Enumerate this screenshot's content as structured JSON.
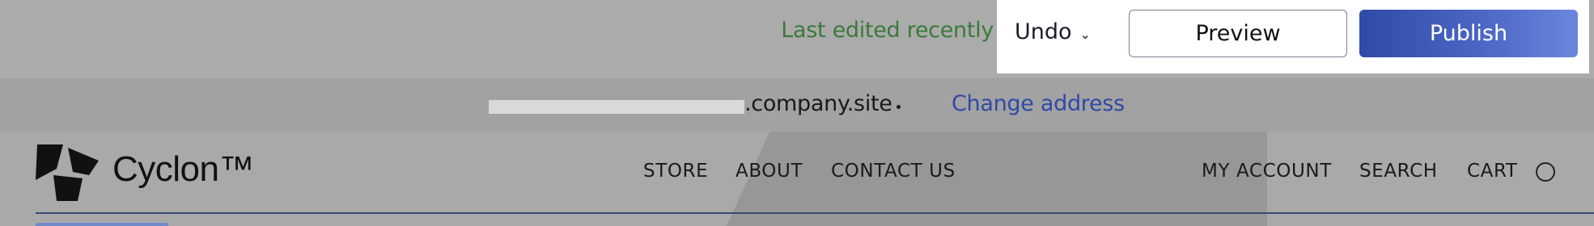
{
  "editor": {
    "last_edited": "Last edited recently",
    "undo_label": "Undo",
    "preview_label": "Preview",
    "publish_label": "Publish"
  },
  "address": {
    "domain_suffix": ".company.site",
    "change_label": "Change address"
  },
  "site": {
    "logo_text": "Cyclon™",
    "nav_left": [
      "STORE",
      "ABOUT",
      "CONTACT US"
    ],
    "nav_right": [
      "MY ACCOUNT",
      "SEARCH",
      "CART"
    ]
  },
  "colors": {
    "publish_accent": "#2f4aa6",
    "last_edited": "#3b7a3a",
    "link": "#2f4aa6"
  }
}
